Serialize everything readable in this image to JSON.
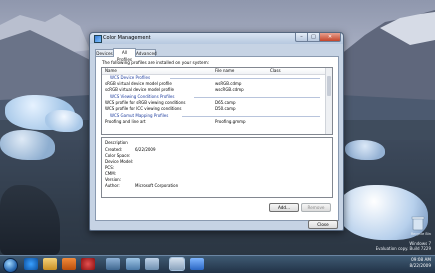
{
  "dialog": {
    "title": "Color Management",
    "tabs": [
      {
        "label": "Devices"
      },
      {
        "label": "All Profiles"
      },
      {
        "label": "Advanced"
      }
    ],
    "intro": "The following profiles are installed on your system:",
    "columns": {
      "name": "Name",
      "file": "File name",
      "class": "Class"
    },
    "groups": [
      {
        "label": "WCS Device Profiles",
        "rows": [
          {
            "name": "sRGB virtual device model profile",
            "file": "wsRGB.cdmp",
            "class": ""
          },
          {
            "name": "scRGB virtual device model profile",
            "file": "wscRGB.cdmp",
            "class": ""
          }
        ]
      },
      {
        "label": "WCS Viewing Conditions Profiles",
        "rows": [
          {
            "name": "WCS profile for sRGB viewing conditions",
            "file": "D65.camp",
            "class": ""
          },
          {
            "name": "WCS profile for ICC viewing conditions",
            "file": "D50.camp",
            "class": ""
          }
        ]
      },
      {
        "label": "WCS Gamut Mapping Profiles",
        "rows": [
          {
            "name": "Proofing and line art",
            "file": "Proofing.gmmp",
            "class": ""
          }
        ]
      }
    ],
    "description": {
      "heading": "Description",
      "fields": [
        {
          "label": "Created:",
          "value": "6/22/2009"
        },
        {
          "label": "Color Space:",
          "value": ""
        },
        {
          "label": "Device Model:",
          "value": ""
        },
        {
          "label": "PCS:",
          "value": ""
        },
        {
          "label": "CMM:",
          "value": ""
        },
        {
          "label": "Version:",
          "value": ""
        },
        {
          "label": "Author:",
          "value": "Microsoft Corporation"
        }
      ]
    },
    "buttons": {
      "add": "Add...",
      "remove": "Remove",
      "close": "Close"
    }
  },
  "desktop": {
    "watermark": [
      "Windows 7",
      "Evaluation copy. Build 7229"
    ],
    "recycle_bin": "Recycle Bin"
  },
  "taskbar": {
    "time": "09:08 AM",
    "date": "8/22/2009"
  }
}
